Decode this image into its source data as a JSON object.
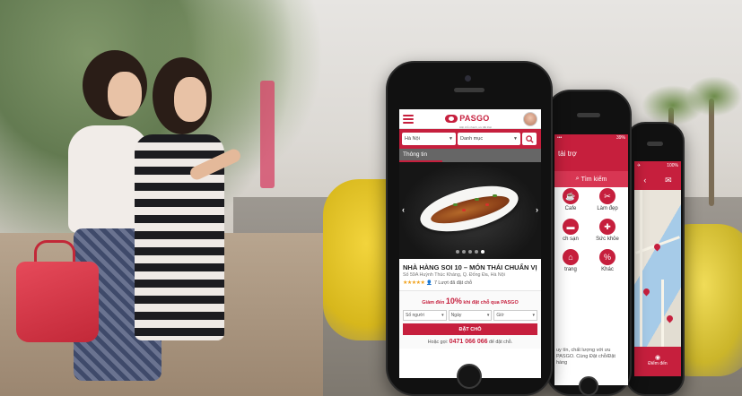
{
  "phone_main": {
    "brand": "PASGO",
    "brand_tagline": "Đặt chỗ nhanh, ưu đãi thật",
    "city_select": "Hà Nội",
    "category_select": "Danh mục",
    "section_tab": "Thông tin",
    "restaurant_title": "NHÀ HÀNG SOI 10 – MÓN THÁI CHUẨN VỊ",
    "address": "Số 59A Huỳnh Thúc Kháng, Q. Đống Đa, Hà Nội",
    "rating_stars": "★★★★★",
    "booked_count": "7 Lượt đã đặt chỗ",
    "promo_prefix": "Giảm đến",
    "promo_value": "10%",
    "promo_suffix": "khi đặt chỗ qua PASGO",
    "field_people": "Số người",
    "field_date": "Ngày",
    "field_time": "Giờ",
    "book_button": "ĐẶT CHỖ",
    "call_prefix": "Hoặc gọi:",
    "phone_number": "0471 066 066",
    "call_suffix": "để đặt chỗ."
  },
  "phone_middle": {
    "status_left": "•••",
    "status_right": "39%",
    "header_title": "tài trợ",
    "search_label": "Tìm kiếm",
    "categories": [
      {
        "label": "Cafe",
        "icon": "cup-icon"
      },
      {
        "label": "Làm đẹp",
        "icon": "scissors-icon"
      },
      {
        "label": "ch sạn",
        "icon": "bed-icon"
      },
      {
        "label": "Sức khỏe",
        "icon": "medical-cross-icon"
      },
      {
        "label": "trang",
        "icon": "hanger-icon"
      },
      {
        "label": "Khác",
        "icon": "percent-icon"
      }
    ],
    "footer_text": "uy tín, chất lượng với ưu PASGO. Cùng Đặt chỗ/Đặt hàng"
  },
  "phone_back": {
    "status_right": "100%",
    "bottom_label": "Điểm đến"
  },
  "colors": {
    "brand_red": "#c61f3d",
    "star_orange": "#f0a11b"
  }
}
